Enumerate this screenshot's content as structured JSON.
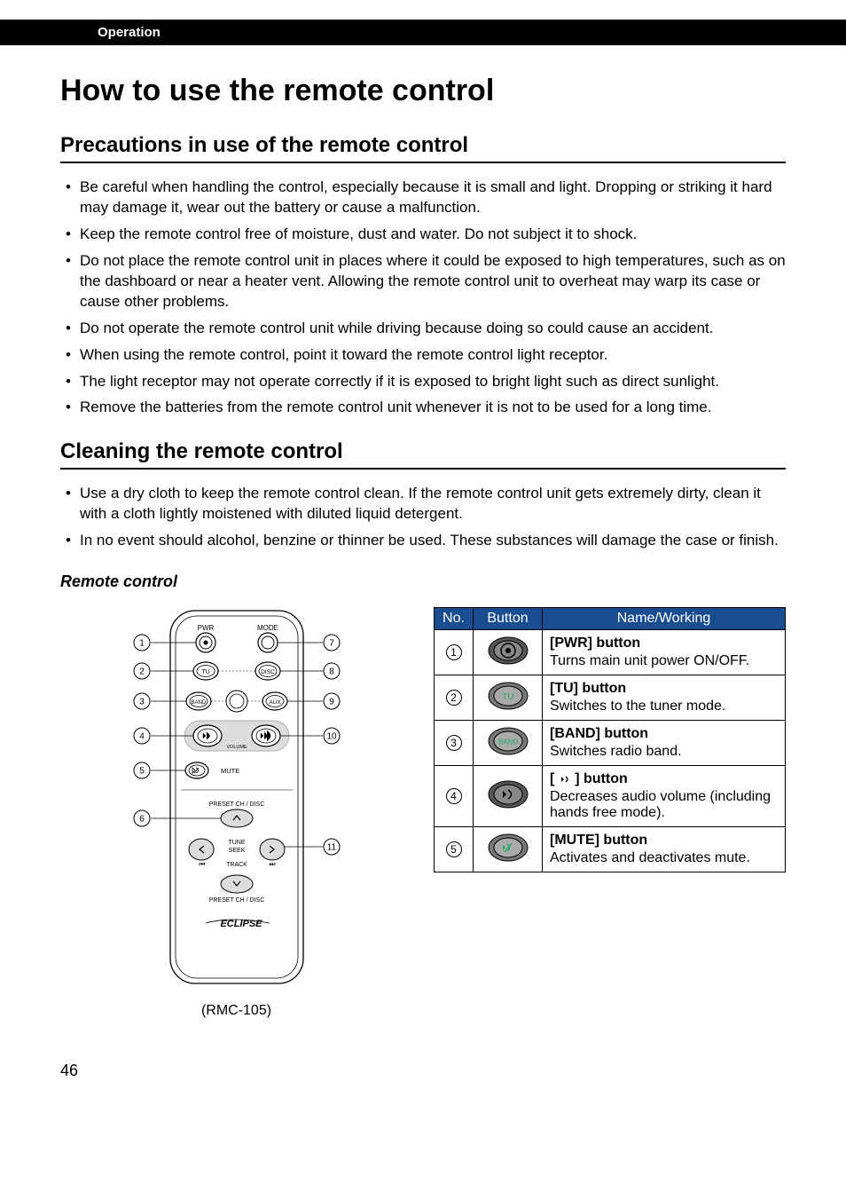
{
  "header": {
    "section": "Operation"
  },
  "page": {
    "title": "How to use the remote control",
    "number": "46"
  },
  "sections": {
    "precautions": {
      "heading": "Precautions in use of the remote control",
      "bullets": [
        "Be careful when handling the control, especially because it is small and light. Dropping or striking it hard may damage it, wear out the battery or cause a malfunction.",
        "Keep the remote control free of moisture, dust and water. Do not subject it to shock.",
        "Do not place the remote control unit in places where it could be exposed to high temperatures, such as on the dashboard or near a heater vent. Allowing the remote control unit to overheat may warp its case or cause other problems.",
        "Do not operate the remote control unit while driving because doing so could cause an accident.",
        "When using the remote control, point it toward the remote control light receptor.",
        "The light receptor may not operate correctly if it is exposed to bright light such as direct sunlight.",
        "Remove the batteries from the remote control unit whenever it is not to be used for a long time."
      ]
    },
    "cleaning": {
      "heading": "Cleaning the remote control",
      "bullets": [
        "Use a dry cloth to keep the remote control clean. If the remote control unit gets extremely dirty, clean it with a cloth lightly moistened with diluted liquid detergent.",
        "In no event should alcohol, benzine or thinner be used. These substances will damage the case or finish."
      ]
    },
    "remote_figure": {
      "heading": "Remote control",
      "caption": "(RMC-105)",
      "top_labels": {
        "pwr": "PWR",
        "mode": "MODE"
      },
      "btn_labels": {
        "tu": "TU",
        "disc": "DISC",
        "band": "BAND",
        "aux": "AUX",
        "volume": "VOLUME",
        "mute": "MUTE"
      },
      "mid_labels": {
        "preset": "PRESET CH / DISC",
        "tune_seek": "TUNE\nSEEK",
        "track": "TRACK"
      },
      "brand": "ECLIPSE",
      "callouts_left": [
        "1",
        "2",
        "3",
        "4",
        "5",
        "6"
      ],
      "callouts_right": [
        "7",
        "8",
        "9",
        "10",
        "11"
      ]
    },
    "table": {
      "headers": {
        "no": "No.",
        "button": "Button",
        "working": "Name/Working"
      },
      "rows": [
        {
          "no": "1",
          "icon": "pwr",
          "name": "[PWR] button",
          "work": "Turns main unit power ON/OFF."
        },
        {
          "no": "2",
          "icon": "tu",
          "name": "[TU] button",
          "work": "Switches to the tuner mode."
        },
        {
          "no": "3",
          "icon": "band",
          "name": "[BAND] button",
          "work": "Switches radio band."
        },
        {
          "no": "4",
          "icon": "voldown",
          "name_prefix": "[ ",
          "name_suffix": " ] button",
          "work": "Decreases audio volume (including hands free mode)."
        },
        {
          "no": "5",
          "icon": "mute",
          "name": "[MUTE] button",
          "work": "Activates and deactivates mute."
        }
      ]
    }
  }
}
